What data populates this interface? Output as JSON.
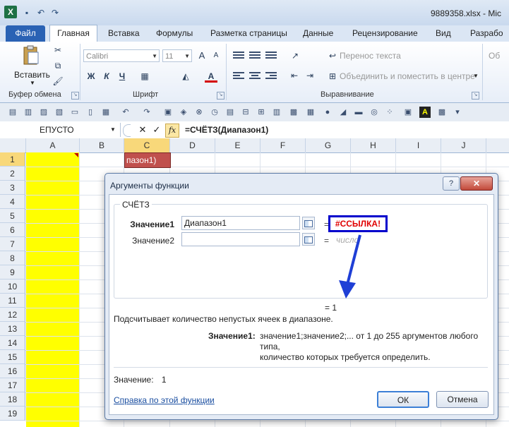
{
  "window": {
    "title": "9889358.xlsx - Mic",
    "logo": "X"
  },
  "ribbon": {
    "tabs": [
      "Файл",
      "Главная",
      "Вставка",
      "Формулы",
      "Разметка страницы",
      "Данные",
      "Рецензирование",
      "Вид",
      "Разрабо"
    ],
    "active_tab": "Главная",
    "clipboard": {
      "paste_label": "Вставить",
      "group_label": "Буфер обмена"
    },
    "font": {
      "name": "Calibri",
      "size": "11",
      "group_label": "Шрифт",
      "bold": "Ж",
      "italic": "К",
      "underline": "Ч",
      "grow": "A",
      "shrink": "A"
    },
    "alignment": {
      "wrap_label": "Перенос текста",
      "merge_label": "Объединить и поместить в центре",
      "group_label": "Выравнивание"
    },
    "number": {
      "format_partial": "Об"
    }
  },
  "formula_bar": {
    "name_box": "ЕПУСТО",
    "cancel": "✕",
    "enter": "✓",
    "fx": "fx",
    "formula": "=СЧЁТЗ(Диапазон1)"
  },
  "grid": {
    "columns": [
      "A",
      "B",
      "C",
      "D",
      "E",
      "F",
      "G",
      "H",
      "I",
      "J"
    ],
    "rows": [
      "1",
      "2",
      "3",
      "4",
      "5",
      "6",
      "7",
      "8",
      "9",
      "10",
      "11",
      "12",
      "13",
      "14",
      "15",
      "16",
      "17",
      "18",
      "19"
    ],
    "cell_c1_text": "пазон1)",
    "colors": {
      "column_a_fill": "#ffff00",
      "active_cell_fill": "#c0504d"
    }
  },
  "dialog": {
    "title": "Аргументы функции",
    "help_button": "?",
    "close_button": "✕",
    "function_name": "СЧЁТЗ",
    "args": [
      {
        "label": "Значение1",
        "value": "Диапазон1",
        "result": "#ССЫЛКА!"
      },
      {
        "label": "Значение2",
        "value": "",
        "result": "число"
      }
    ],
    "eq_sign": "=",
    "formula_result": "=  1",
    "description": "Подсчитывает количество непустых ячеек в диапазоне.",
    "arg_description_label": "Значение1:",
    "arg_description_line1": "значение1;значение2;... от 1 до 255 аргументов любого типа,",
    "arg_description_line2": "количество которых требуется определить.",
    "value_label": "Значение:",
    "value": "1",
    "help_link": "Справка по этой функции",
    "ok_label": "ОК",
    "cancel_label": "Отмена",
    "colors": {
      "error_text": "#e00000",
      "highlight_border": "#0000cc"
    }
  }
}
